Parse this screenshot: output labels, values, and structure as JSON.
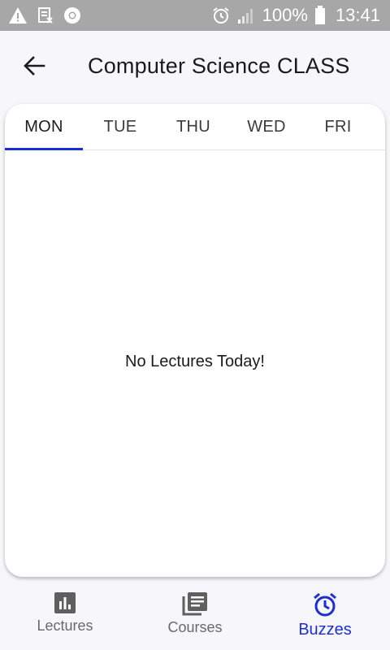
{
  "status_bar": {
    "battery": "100%",
    "time": "13:41",
    "icons": [
      "warning-icon",
      "screenshot-icon",
      "chrome-icon",
      "alarm-icon",
      "signal-icon",
      "battery-icon"
    ]
  },
  "app_bar": {
    "back_icon": "arrow-back-icon",
    "title": "Computer Science CLASS"
  },
  "tabs": [
    {
      "label": "MON",
      "active": true
    },
    {
      "label": "TUE",
      "active": false
    },
    {
      "label": "THU",
      "active": false
    },
    {
      "label": "WED",
      "active": false
    },
    {
      "label": "FRI",
      "active": false
    }
  ],
  "content": {
    "empty_message": "No Lectures Today!"
  },
  "bottom_nav": [
    {
      "label": "Lectures",
      "icon": "bar-chart-icon",
      "active": false
    },
    {
      "label": "Courses",
      "icon": "library-books-icon",
      "active": false
    },
    {
      "label": "Buzzes",
      "icon": "alarm-clock-icon",
      "active": true
    }
  ],
  "colors": {
    "accent": "#1c2ed6",
    "status_bar": "#a7a7a7",
    "background": "#f6f6fb",
    "inactive_icon": "#5f5f5f"
  }
}
